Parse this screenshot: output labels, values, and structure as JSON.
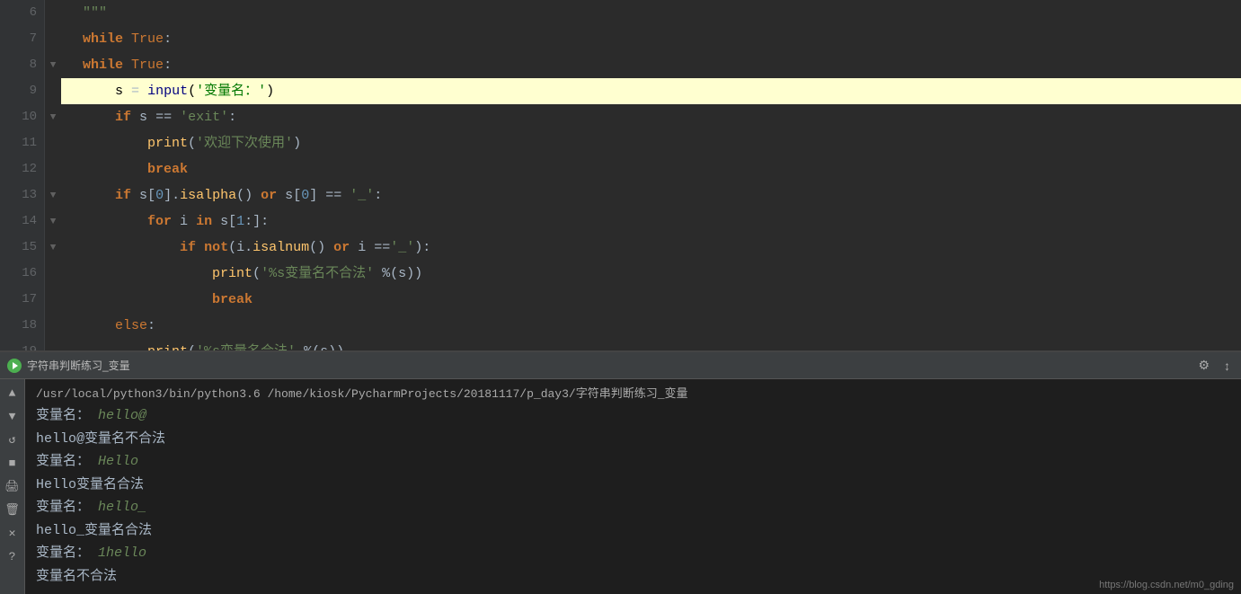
{
  "editor": {
    "lines": [
      {
        "num": "6",
        "fold": "",
        "content_html": "  <span class='str2'>\"\"\"</span>",
        "highlighted": false
      },
      {
        "num": "7",
        "fold": "",
        "content_html": "  <span class='kw'>while</span> <span class='kw2'>True</span>:",
        "highlighted": false
      },
      {
        "num": "8",
        "fold": "▼",
        "content_html": "  <span class='kw'>while</span> <span class='kw2'>True</span>:",
        "highlighted": false
      },
      {
        "num": "9",
        "fold": "",
        "content_html": "      <span class='var'>s</span> <span class='op'>=</span> <span class='func'>input</span>(<span class='str'>'变量名：'</span>)",
        "highlighted": true
      },
      {
        "num": "10",
        "fold": "▼",
        "content_html": "      <span class='kw'>if</span> <span class='var'>s</span> <span class='op'>==</span> <span class='str'>'exit'</span>:",
        "highlighted": false
      },
      {
        "num": "11",
        "fold": "",
        "content_html": "          <span class='func'>print</span>(<span class='str'>'欢迎下次使用'</span>)",
        "highlighted": false
      },
      {
        "num": "12",
        "fold": "",
        "content_html": "          <span class='kw'>break</span>",
        "highlighted": false
      },
      {
        "num": "13",
        "fold": "▼",
        "content_html": "      <span class='kw'>if</span> <span class='var'>s</span>[<span class='num'>0</span>].<span class='func'>isalpha</span>() <span class='kw'>or</span> <span class='var'>s</span>[<span class='num'>0</span>] <span class='op'>==</span> <span class='str'>'_'</span>:",
        "highlighted": false
      },
      {
        "num": "14",
        "fold": "▼",
        "content_html": "          <span class='kw'>for</span> <span class='var'>i</span> <span class='kw'>in</span> <span class='var'>s</span>[<span class='num'>1</span>:]:",
        "highlighted": false
      },
      {
        "num": "15",
        "fold": "▼",
        "content_html": "              <span class='kw'>if</span> <span class='kw'>not</span>(<span class='var'>i</span>.<span class='func'>isalnum</span>() <span class='kw'>or</span> <span class='var'>i</span> <span class='op'>==</span><span class='str'>'_'</span>):",
        "highlighted": false
      },
      {
        "num": "16",
        "fold": "",
        "content_html": "                  <span class='func'>print</span>(<span class='str'>'%s变量名不合法'</span> <span class='op'>%</span>(<span class='var'>s</span>))",
        "highlighted": false
      },
      {
        "num": "17",
        "fold": "",
        "content_html": "                  <span class='kw'>break</span>",
        "highlighted": false
      },
      {
        "num": "18",
        "fold": "",
        "content_html": "      <span class='kw2'>else</span>:",
        "highlighted": false
      },
      {
        "num": "19",
        "fold": "",
        "content_html": "          <span class='func'>print</span>(<span class='str'>'%s变量名合法'</span> <span class='op'>%</span>(<span class='var'>s</span>))",
        "highlighted": false
      }
    ]
  },
  "run_panel": {
    "tab_label": "字符串判断练习_变量",
    "path_line": "/usr/local/python3/bin/python3.6 /home/kiosk/PycharmProjects/20181117/p_day3/字符串判断练习_变量",
    "output_lines": [
      {
        "type": "input-prompt",
        "label": "变量名：",
        "value": "hello@"
      },
      {
        "type": "result",
        "text": "hello@变量名不合法"
      },
      {
        "type": "input-prompt",
        "label": "变量名：",
        "value": "Hello"
      },
      {
        "type": "result",
        "text": "Hello变量名合法"
      },
      {
        "type": "input-prompt",
        "label": "变量名：",
        "value": "hello_"
      },
      {
        "type": "result",
        "text": "hello_变量名合法"
      },
      {
        "type": "input-prompt",
        "label": "变量名：",
        "value": "1hello"
      },
      {
        "type": "result",
        "text": "变量名不合法"
      }
    ]
  },
  "watermark": {
    "text": "https://blog.csdn.net/m0_gding"
  }
}
